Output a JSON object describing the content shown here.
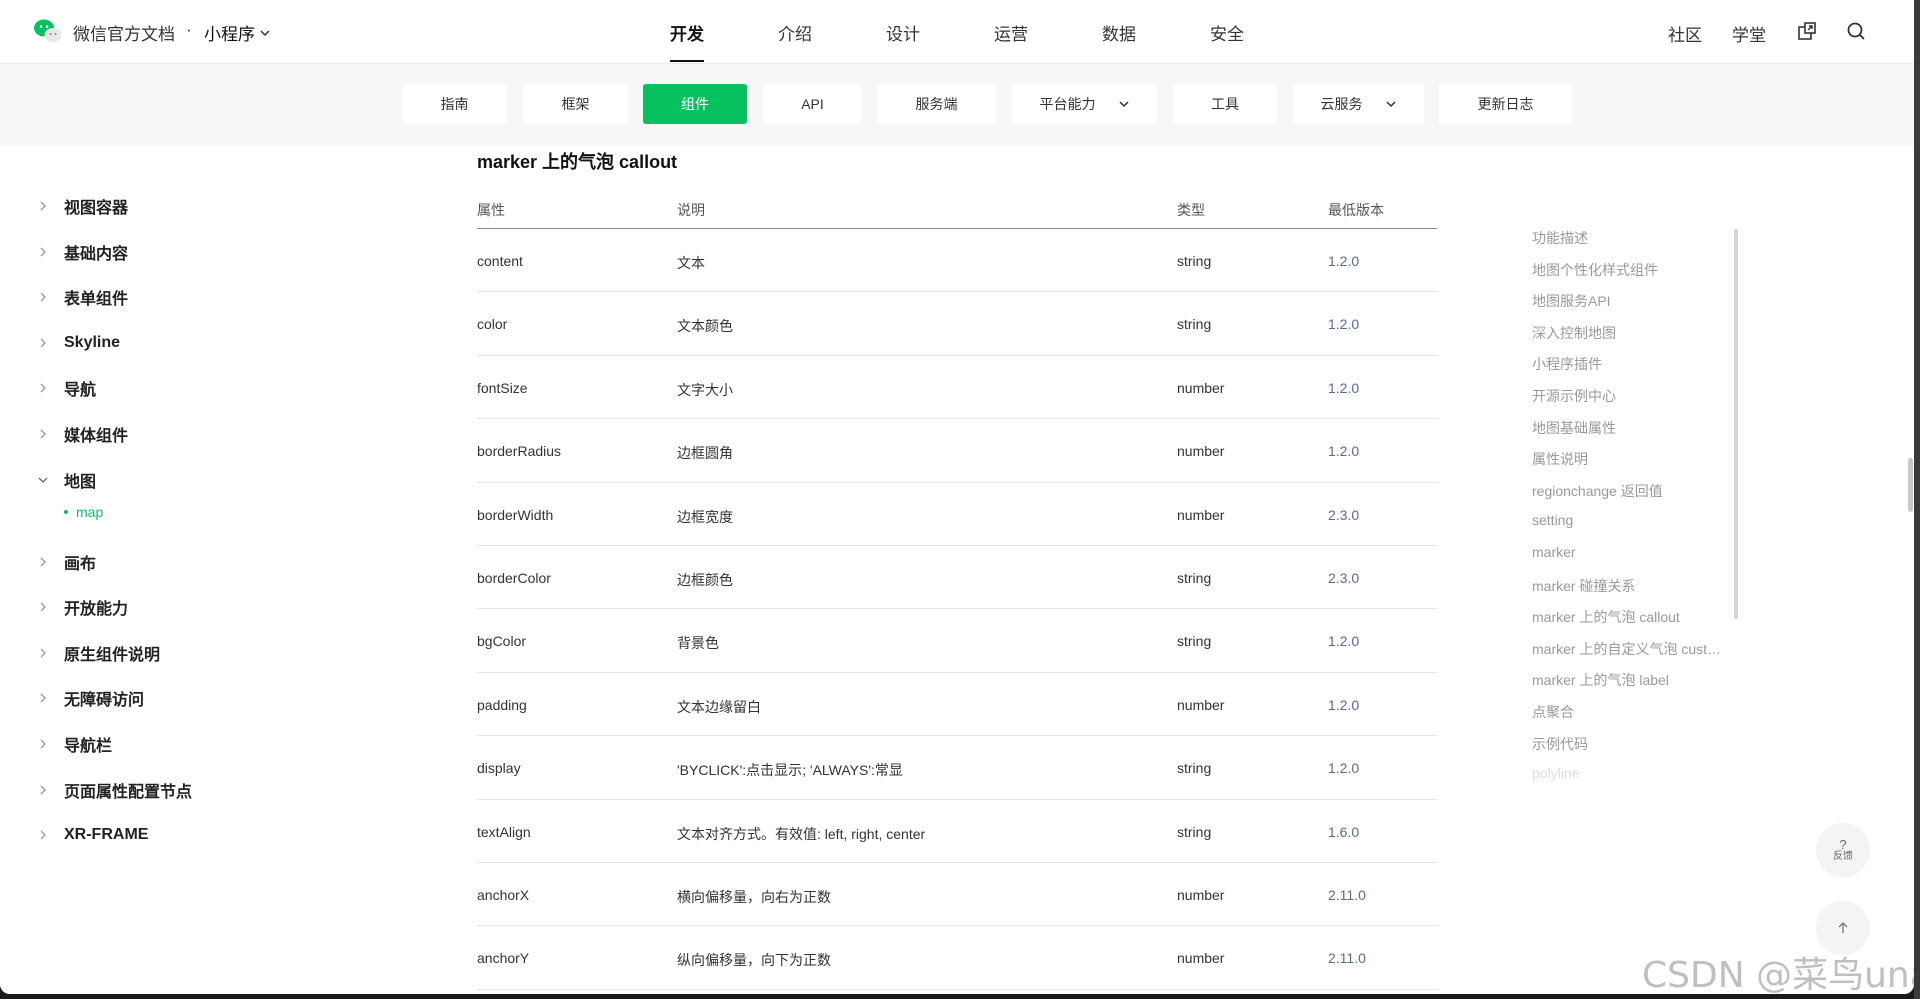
{
  "header": {
    "brand": "微信官方文档",
    "brand_separator": "·",
    "product": "小程序",
    "nav": [
      "开发",
      "介绍",
      "设计",
      "运营",
      "数据",
      "安全"
    ],
    "active_nav": "开发",
    "right_links": [
      "社区",
      "学堂"
    ],
    "right_icons": [
      "external-link-icon",
      "search-icon"
    ]
  },
  "subnav": {
    "tabs": [
      {
        "label": "指南"
      },
      {
        "label": "框架"
      },
      {
        "label": "组件",
        "active": true
      },
      {
        "label": "API"
      },
      {
        "label": "服务端"
      },
      {
        "label": "平台能力",
        "dropdown": true
      },
      {
        "label": "工具"
      },
      {
        "label": "云服务",
        "dropdown": true
      },
      {
        "label": "更新日志"
      }
    ]
  },
  "sidebar": {
    "items": [
      {
        "label": "视图容器"
      },
      {
        "label": "基础内容"
      },
      {
        "label": "表单组件"
      },
      {
        "label": "Skyline"
      },
      {
        "label": "导航"
      },
      {
        "label": "媒体组件"
      },
      {
        "label": "地图",
        "expanded": true
      },
      {
        "label": "画布"
      },
      {
        "label": "开放能力"
      },
      {
        "label": "原生组件说明"
      },
      {
        "label": "无障碍访问"
      },
      {
        "label": "导航栏"
      },
      {
        "label": "页面属性配置节点"
      },
      {
        "label": "XR-FRAME"
      }
    ],
    "active_sub": "map"
  },
  "main": {
    "section_title": "marker 上的气泡 callout",
    "table": {
      "headers": [
        "属性",
        "说明",
        "类型",
        "最低版本"
      ],
      "rows": [
        [
          "content",
          "文本",
          "string",
          "1.2.0"
        ],
        [
          "color",
          "文本颜色",
          "string",
          "1.2.0"
        ],
        [
          "fontSize",
          "文字大小",
          "number",
          "1.2.0"
        ],
        [
          "borderRadius",
          "边框圆角",
          "number",
          "1.2.0"
        ],
        [
          "borderWidth",
          "边框宽度",
          "number",
          "2.3.0"
        ],
        [
          "borderColor",
          "边框颜色",
          "string",
          "2.3.0"
        ],
        [
          "bgColor",
          "背景色",
          "string",
          "1.2.0"
        ],
        [
          "padding",
          "文本边缘留白",
          "number",
          "1.2.0"
        ],
        [
          "display",
          "'BYCLICK':点击显示; 'ALWAYS':常显",
          "string",
          "1.2.0"
        ],
        [
          "textAlign",
          "文本对齐方式。有效值: left, right, center",
          "string",
          "1.6.0"
        ],
        [
          "anchorX",
          "横向偏移量，向右为正数",
          "number",
          "2.11.0"
        ],
        [
          "anchorY",
          "纵向偏移量，向下为正数",
          "number",
          "2.11.0"
        ]
      ]
    }
  },
  "toc": {
    "items": [
      "功能描述",
      "地图个性化样式组件",
      "地图服务API",
      "深入控制地图",
      "小程序插件",
      "开源示例中心",
      "地图基础属性",
      "属性说明",
      "regionchange 返回值",
      "setting",
      "marker",
      "marker 碰撞关系",
      "marker 上的气泡 callout",
      "marker 上的自定义气泡 customCallout",
      "marker 上的气泡 label",
      "点聚合",
      "示例代码",
      "polyline"
    ]
  },
  "float": {
    "feedback_symbol": "?",
    "feedback_label": "反馈",
    "back_to_top_icon": "arrow-up-icon"
  },
  "watermark": "CSDN @菜鸟una",
  "colors": {
    "accent": "#07c160",
    "version_link": "#576b95",
    "toc_text": "#999999"
  }
}
